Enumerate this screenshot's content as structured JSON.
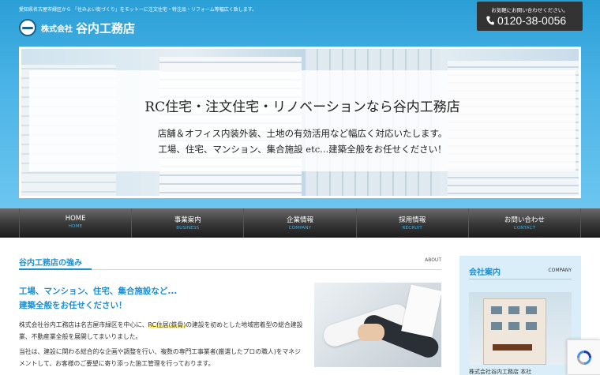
{
  "header": {
    "tagline": "愛知県名古屋市緑区から 「住みよい街づくり」をモットーに注文住宅・特注品・リフォーム等幅広く致します。",
    "logo_small": "株式会社",
    "logo_name": "谷内工務店",
    "contact_caption": "お気軽にお問い合わせください。",
    "phone": "0120-38-0056"
  },
  "hero": {
    "title": "RC住宅・注文住宅・リノベーションなら谷内工務店",
    "line1": "店舗＆オフィス内装外装、土地の有効活用など幅広く対応いたします。",
    "line2": "工場、住宅、マンション、集合施設 etc...建築全般をお任せください！"
  },
  "nav": [
    {
      "label": "HOME",
      "sub": "HOME"
    },
    {
      "label": "事業案内",
      "sub": "BUSINESS"
    },
    {
      "label": "企業情報",
      "sub": "COMPANY"
    },
    {
      "label": "採用情報",
      "sub": "RECRUIT"
    },
    {
      "label": "お問い合わせ",
      "sub": "CONTACT"
    }
  ],
  "main": {
    "section_title": "谷内工務店の強み",
    "section_sub": "ABOUT",
    "lead_line1": "工場、マンション、住宅、集合施設など...",
    "lead_line2": "建築全般をお任せください！",
    "para1_before": "株式会社谷内工務店は名古屋市緑区を中心に、",
    "para1_highlight": "RC住居(鉄骨)",
    "para1_after": "の建設を初めとした地域密着型の総合建設業、不動産業全般を展開してまいりました。",
    "para2": "当社は、建設に関わる総合的な企画や調整を行い、複数の専門工事業者(厳選したプロの職人)をマネジメントして、お客様のご要望に寄り添った施工管理を行っております。"
  },
  "sidebar": {
    "title": "会社案内",
    "sub": "COMPANY",
    "caption": "株式会社谷内工務店 本社"
  },
  "colors": {
    "accent": "#1f8fcf",
    "header_bg": "#2a9fd6",
    "nav_sub": "#39b1ea"
  }
}
